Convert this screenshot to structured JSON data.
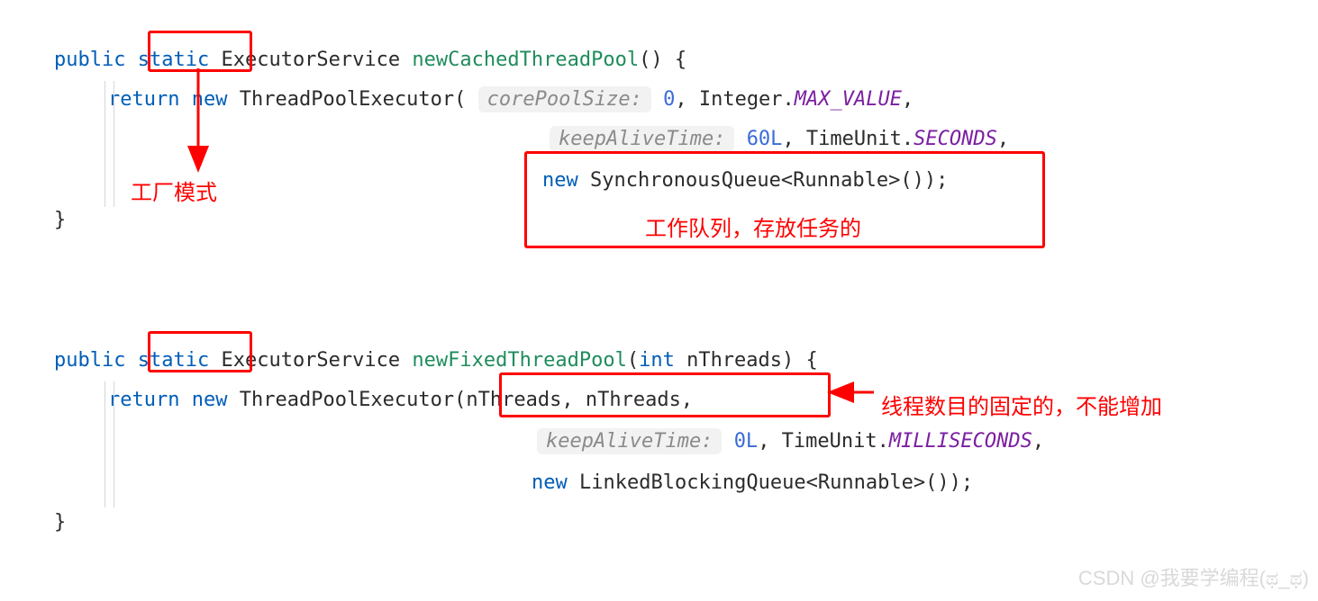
{
  "block1": {
    "l1": {
      "public": "public",
      "static": "static",
      "svc": "ExecutorService",
      "method": "newCachedThreadPool",
      "tail": "() {"
    },
    "l2": {
      "ret": "return",
      "new": "new",
      "ctor": "ThreadPoolExecutor(",
      "hint1": "corePoolSize:",
      "zero": "0",
      "comma1": ", Integer.",
      "max": "MAX_VALUE",
      "tailc": ","
    },
    "l3": {
      "hint2": "keepAliveTime:",
      "sixty": "60L",
      "comma2": ", TimeUnit.",
      "sec": "SECONDS",
      "tailc": ","
    },
    "l4": {
      "new": "new",
      "rest": " SynchronousQueue<Runnable>());"
    },
    "close": "}"
  },
  "block2": {
    "l1": {
      "public": "public",
      "static": "static",
      "svc": "ExecutorService",
      "method": "newFixedThreadPool",
      "args": "(",
      "int": "int",
      "argtail": " nThreads) {"
    },
    "l2": {
      "ret": "return",
      "new": "new",
      "ctor": "ThreadPoolExecutor",
      "params": "(nThreads, nThreads,"
    },
    "l3": {
      "hint": "keepAliveTime:",
      "zero": "0L",
      "comma": ", TimeUnit.",
      "ms": "MILLISECONDS",
      "tailc": ","
    },
    "l4": {
      "new": "new",
      "rest": " LinkedBlockingQueue<Runnable>());"
    },
    "close": "}"
  },
  "annotations": {
    "factory": "工厂模式",
    "queue": "工作队列，存放任务的",
    "fixed": "线程数目的固定的，不能增加"
  },
  "watermark": "CSDN @我要学编程(ಥ_ಥ)"
}
